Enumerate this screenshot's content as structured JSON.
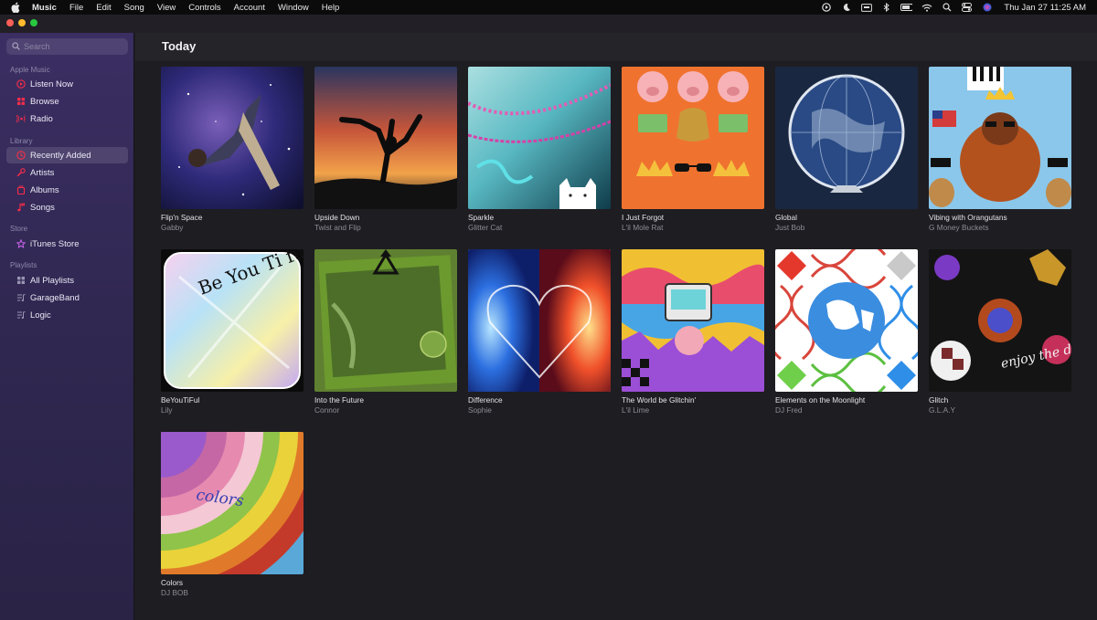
{
  "menubar": {
    "app_name": "Music",
    "menus": [
      "File",
      "Edit",
      "Song",
      "View",
      "Controls",
      "Account",
      "Window",
      "Help"
    ],
    "clock": "Thu Jan 27  11:25 AM"
  },
  "sidebar": {
    "search_placeholder": "Search",
    "sections": {
      "apple_music": "Apple Music",
      "library": "Library",
      "store": "Store",
      "playlists": "Playlists"
    },
    "items": {
      "listen_now": "Listen Now",
      "browse": "Browse",
      "radio": "Radio",
      "recently_added": "Recently Added",
      "artists": "Artists",
      "albums": "Albums",
      "songs": "Songs",
      "itunes_store": "iTunes Store",
      "all_playlists": "All Playlists",
      "garageband": "GarageBand",
      "logic": "Logic"
    },
    "accent_color": "#fa2d48"
  },
  "main": {
    "title": "Today",
    "albums": [
      {
        "title": "Flip'n Space",
        "artist": "Gabby"
      },
      {
        "title": "Upside Down",
        "artist": "Twist and Flip"
      },
      {
        "title": "Sparkle",
        "artist": "Glitter Cat"
      },
      {
        "title": "I Just Forgot",
        "artist": "L'il Mole Rat"
      },
      {
        "title": "Global",
        "artist": "Just Bob"
      },
      {
        "title": "Vibing with Orangutans",
        "artist": "G Money Buckets"
      },
      {
        "title": "BeYouTiFul",
        "artist": "Lily"
      },
      {
        "title": "Into the Future",
        "artist": "Connor"
      },
      {
        "title": "Difference",
        "artist": "Sophie"
      },
      {
        "title": "The World be Glitchin'",
        "artist": "L'il Lime"
      },
      {
        "title": "Elements on the Moonlight",
        "artist": "DJ Fred"
      },
      {
        "title": "Glitch",
        "artist": "G.L.A.Y"
      },
      {
        "title": " Colors",
        "artist": "DJ BOB"
      }
    ]
  },
  "artwork_text": {
    "beyoutiful": "Be You Ti ful",
    "colors": "colors",
    "glitch": "enjoy the day"
  }
}
